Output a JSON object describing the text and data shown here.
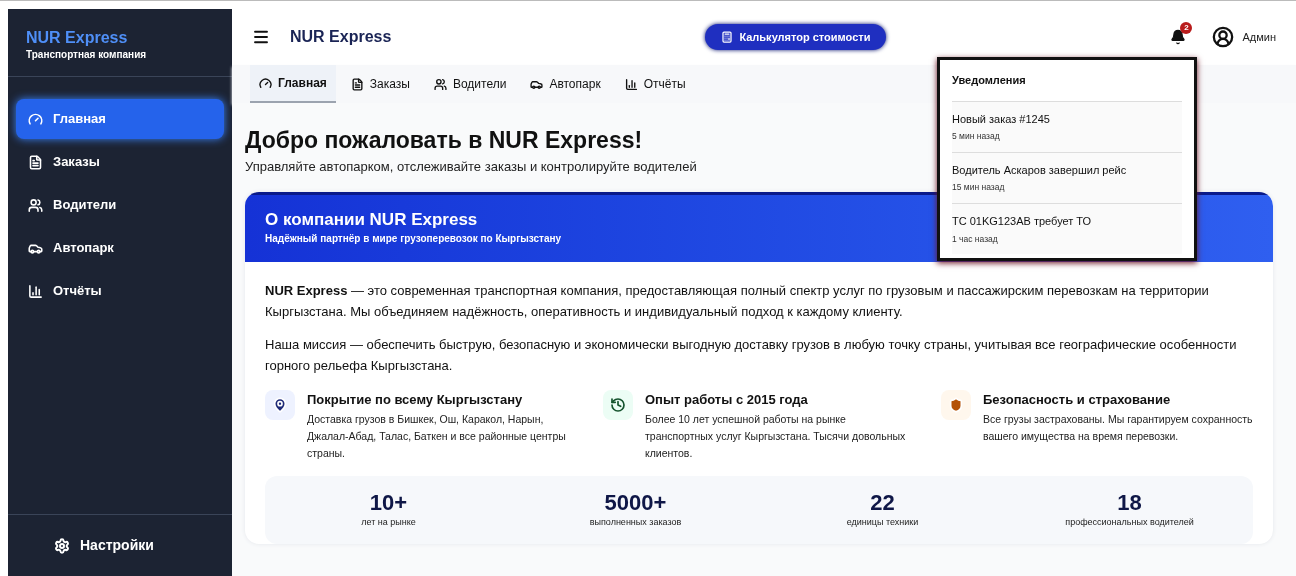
{
  "sidebar": {
    "brand": "NUR Express",
    "tagline": "Транспортная компания",
    "items": [
      {
        "label": "Главная",
        "selected": true
      },
      {
        "label": "Заказы",
        "selected": false
      },
      {
        "label": "Водители",
        "selected": false
      },
      {
        "label": "Автопарк",
        "selected": false
      },
      {
        "label": "Отчёты",
        "selected": false
      }
    ],
    "settings": "Настройки"
  },
  "header": {
    "title": "NUR Express",
    "calculator_button": "Калькулятор стоимости",
    "notification_count": "2",
    "user": "Админ"
  },
  "tabs": [
    {
      "label": "Главная",
      "selected": true
    },
    {
      "label": "Заказы",
      "selected": false
    },
    {
      "label": "Водители",
      "selected": false
    },
    {
      "label": "Автопарк",
      "selected": false
    },
    {
      "label": "Отчёты",
      "selected": false
    }
  ],
  "notifications": {
    "title": "Уведомления",
    "items": [
      {
        "text": "Новый заказ #1245",
        "time": "5 мин назад"
      },
      {
        "text": "Водитель Аскаров завершил рейс",
        "time": "15 мин назад"
      },
      {
        "text": "ТС 01KG123AB требует ТО",
        "time": "1 час назад"
      }
    ]
  },
  "welcome": {
    "title": "Добро пожаловать в NUR Express!",
    "subtitle": "Управляйте автопарком, отслеживайте заказы и контролируйте водителей"
  },
  "about": {
    "title": "О компании NUR Express",
    "subtitle": "Надёжный партнёр в мире грузоперевозок по Кыргызстану",
    "paragraphs": [
      "**NUR Express** — это современная транспортная компания, предоставляющая полный спектр услуг по грузовым и пассажирским перевозкам на территории Кыргызстана. Мы объединяем надёжность, оперативность и индивидуальный подход к каждому клиенту.",
      "Наша миссия — обеспечить быструю, безопасную и экономически выгодную доставку грузов в любую точку страны, учитывая все географические особенности горного рельефа Кыргызстана."
    ],
    "features": [
      {
        "kind": "location",
        "title": "Покрытие по всему Кыргызстану",
        "text": "Доставка грузов в Бишкек, Ош, Каракол, Нарын, Джалал-Абад, Талас, Баткен и все районные центры страны."
      },
      {
        "kind": "history",
        "title": "Опыт работы с 2015 года",
        "text": "Более 10 лет успешной работы на рынке транспортных услуг Кыргызстана. Тысячи довольных клиентов."
      },
      {
        "kind": "security",
        "title": "Безопасность и страхование",
        "text": "Все грузы застрахованы. Мы гарантируем сохранность вашего имущества на время перевозки."
      }
    ],
    "stats": [
      {
        "value": "10+",
        "label": "лет на рынке"
      },
      {
        "value": "5000+",
        "label": "выполненных заказов"
      },
      {
        "value": "22",
        "label": "единицы техники"
      },
      {
        "value": "18",
        "label": "профессиональных водителей"
      }
    ]
  }
}
